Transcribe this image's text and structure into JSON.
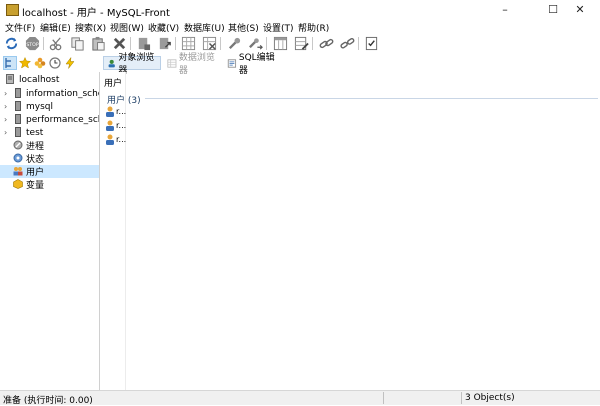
{
  "window": {
    "title": "localhost - 用户 - MySQL-Front",
    "minimize": "–",
    "maximize": "☐",
    "close": "✕"
  },
  "menu": [
    "文件(F)",
    "编辑(E)",
    "搜索(X)",
    "视图(W)",
    "收藏(V)",
    "数据库(U)",
    "其他(S)",
    "设置(T)",
    "帮助(R)"
  ],
  "toolbar": {
    "icons": [
      "refresh-icon",
      "stop-icon",
      "cut-icon",
      "copy-icon",
      "paste-icon",
      "delete-icon",
      "import-icon",
      "export-icon",
      "grid-icon",
      "grid-delete-icon",
      "tools-icon",
      "tools-arrow-icon",
      "table-icon",
      "table-edit-icon",
      "link-icon",
      "unlink-icon",
      "checklist-icon"
    ]
  },
  "sidebar_toolbar": [
    "tree-icon",
    "star-icon",
    "flower-icon",
    "clock-icon",
    "bolt-icon"
  ],
  "tabs": [
    {
      "label": "对象浏览器",
      "active": true,
      "disabled": false
    },
    {
      "label": "数据浏览器",
      "active": false,
      "disabled": true
    },
    {
      "label": "SQL编辑器",
      "active": false,
      "disabled": false
    }
  ],
  "tree": [
    {
      "label": "localhost",
      "icon": "server-icon",
      "expander": "",
      "level": 0
    },
    {
      "label": "information_schema",
      "icon": "database-icon",
      "expander": "›",
      "level": 1
    },
    {
      "label": "mysql",
      "icon": "database-icon",
      "expander": "›",
      "level": 1
    },
    {
      "label": "performance_schema",
      "icon": "database-icon",
      "expander": "›",
      "level": 1
    },
    {
      "label": "test",
      "icon": "database-icon",
      "expander": "›",
      "level": 1
    },
    {
      "label": "进程",
      "icon": "process-icon",
      "expander": "",
      "level": 1
    },
    {
      "label": "状态",
      "icon": "status-icon",
      "expander": "",
      "level": 1
    },
    {
      "label": "用户",
      "icon": "users-icon",
      "expander": "",
      "level": 1,
      "selected": true
    },
    {
      "label": "变量",
      "icon": "variables-icon",
      "expander": "",
      "level": 1
    }
  ],
  "content": {
    "header": "用户",
    "group_label": "用户 (3)",
    "users": [
      "r...",
      "r...",
      "r..."
    ]
  },
  "status": {
    "left": "准备  (执行时间: 0.00)",
    "right": "3 Object(s)"
  },
  "colors": {
    "selection": "#cce8ff",
    "accent": "#1e3f66"
  }
}
